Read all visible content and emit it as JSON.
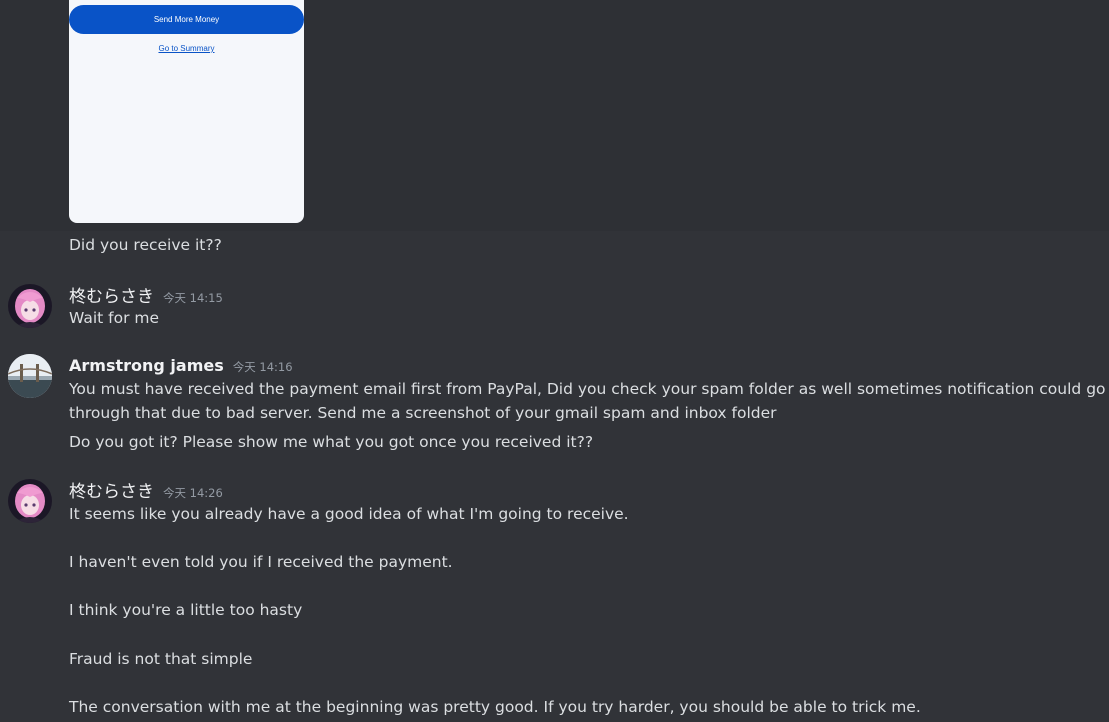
{
  "attachment": {
    "button_label": "Send More Money",
    "link_label": "Go to Summary"
  },
  "messages": [
    {
      "text": "Did you receive it??"
    },
    {
      "author": "柊むらさき",
      "timestamp": "今天 14:15",
      "lines": [
        "Wait for me"
      ]
    },
    {
      "author": "Armstrong james",
      "timestamp": "今天 14:16",
      "lines": [
        "You must have received the payment email first from PayPal, Did you check your spam folder as well sometimes notification could go",
        "through that due to bad server. Send me a screenshot of your gmail spam and inbox folder",
        "Do you got it? Please show me what you got once you received it??"
      ]
    },
    {
      "author": "柊むらさき",
      "timestamp": "今天 14:26",
      "lines": [
        "It seems like you already have a good idea of what I'm going to receive.",
        "I haven't even told you if I received the payment.",
        "I think you're a little too hasty",
        "Fraud is not that simple",
        "The conversation with me at the beginning was pretty good. If you try harder, you should be able to trick me."
      ]
    }
  ]
}
